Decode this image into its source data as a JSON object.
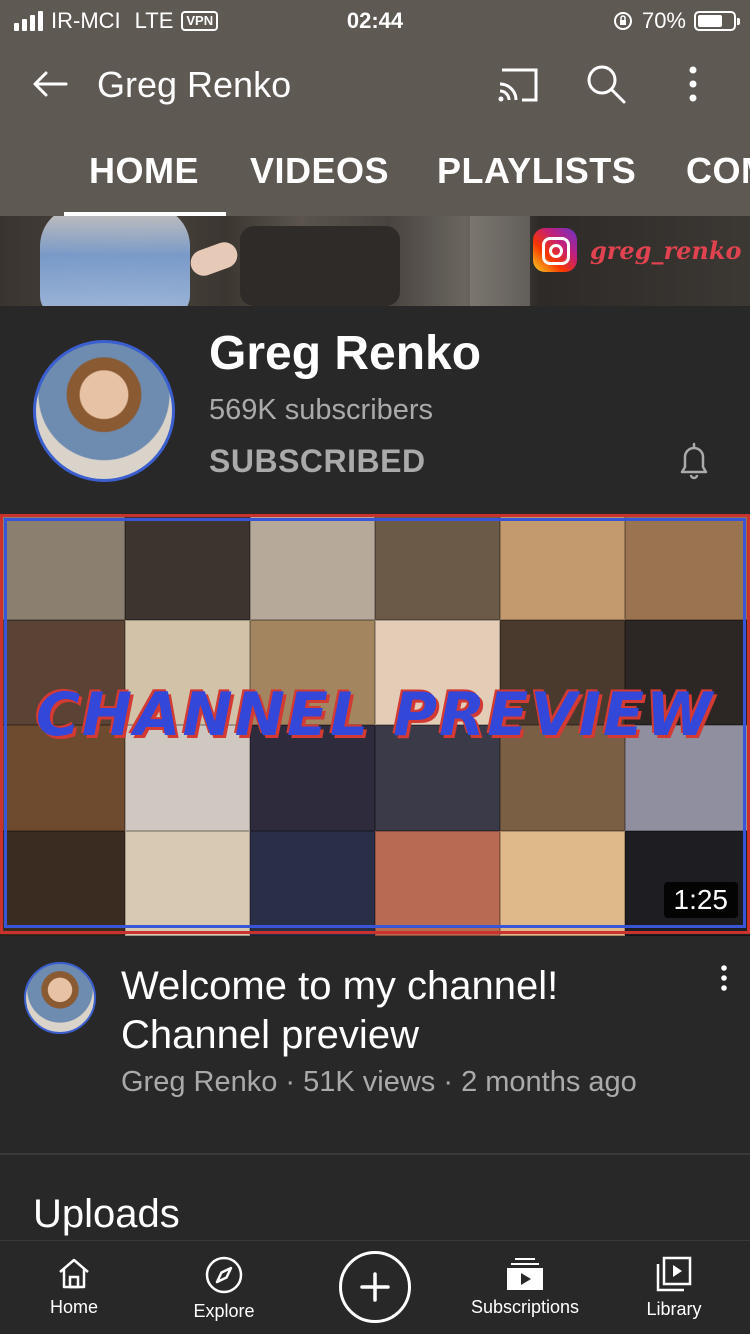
{
  "status_bar": {
    "carrier": "IR-MCI",
    "network": "LTE",
    "vpn": "VPN",
    "time": "02:44",
    "battery": "70%"
  },
  "app_bar": {
    "title": "Greg Renko"
  },
  "tabs": [
    {
      "label": "HOME",
      "active": true
    },
    {
      "label": "VIDEOS",
      "active": false
    },
    {
      "label": "PLAYLISTS",
      "active": false
    },
    {
      "label": "COMMUNITY",
      "active": false
    }
  ],
  "banner": {
    "social_handle": "greg_renko"
  },
  "channel": {
    "name": "Greg Renko",
    "subscribers": "569K subscribers",
    "subscribe_state": "SUBSCRIBED"
  },
  "featured_video": {
    "thumbnail_text": "CHANNEL PREVIEW",
    "duration": "1:25",
    "title": "Welcome to my channel! Channel preview",
    "meta": "Greg Renko · 51K views · 2 months ago"
  },
  "sections": {
    "uploads": "Uploads"
  },
  "bottom_nav": [
    {
      "label": "Home",
      "icon": "home-icon"
    },
    {
      "label": "Explore",
      "icon": "compass-icon"
    },
    {
      "label": "",
      "icon": "plus-icon"
    },
    {
      "label": "Subscriptions",
      "icon": "subscriptions-icon"
    },
    {
      "label": "Library",
      "icon": "library-icon"
    }
  ],
  "colors": {
    "header_bg": "#5f5954",
    "page_bg": "#282828",
    "secondary_text": "#aaaaaa",
    "avatar_ring": "#3b5fcf"
  }
}
